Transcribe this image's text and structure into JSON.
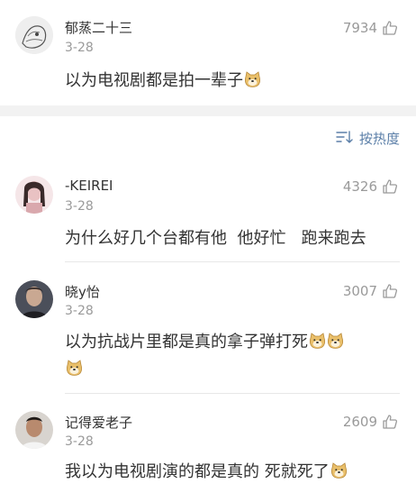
{
  "comments_top": [
    {
      "name": "郁蒸二十三",
      "date": "3-28",
      "likes": "7934",
      "text": "以为电视剧都是拍一辈子",
      "emoji_count": 1
    }
  ],
  "sort": {
    "label": "按热度"
  },
  "comments": [
    {
      "name": "-KEIREI",
      "date": "3-28",
      "likes": "4326",
      "text": "为什么好几个台都有他  他好忙   跑来跑去",
      "emoji_count": 0
    },
    {
      "name": "晓y怡",
      "date": "3-28",
      "likes": "3007",
      "text": "以为抗战片里都是真的拿子弹打死",
      "emoji_count": 3
    },
    {
      "name": "记得爱老子",
      "date": "3-28",
      "likes": "2609",
      "text": "我以为电视剧演的都是真的 死就死了",
      "emoji_count": 1
    }
  ],
  "icons": {
    "like": "thumbs-up-icon",
    "sort": "sort-icon",
    "emoji": "doge-emoji-icon"
  },
  "colors": {
    "link": "#5b7fa8",
    "muted": "#9a9a9a",
    "text": "#333333",
    "separator": "#f2f2f2"
  }
}
